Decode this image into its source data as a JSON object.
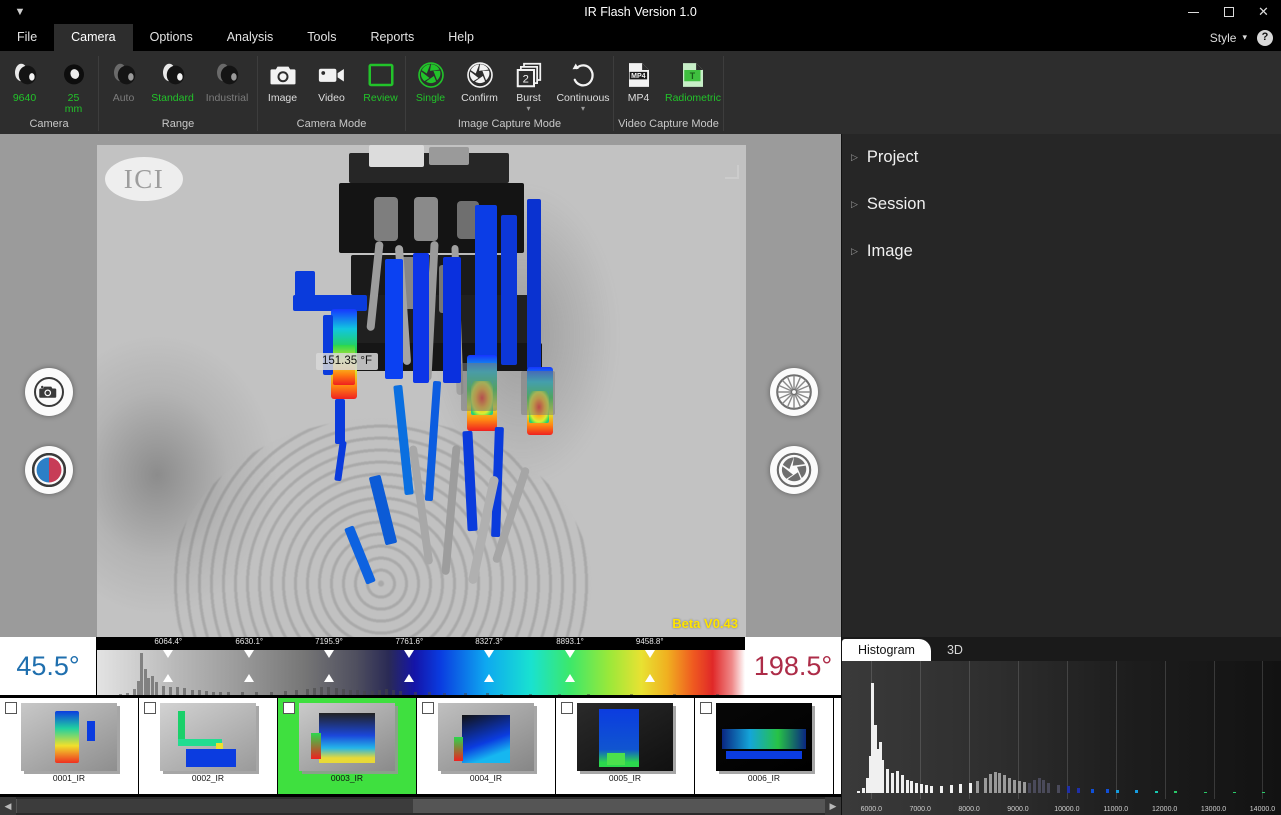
{
  "window": {
    "title": "IR Flash Version 1.0",
    "qat_icon": "quick-access-caret-icon",
    "minimize": "–",
    "maximize": "□",
    "close": "✕"
  },
  "menu": {
    "items": [
      {
        "label": "File",
        "active": false
      },
      {
        "label": "Camera",
        "active": true
      },
      {
        "label": "Options",
        "active": false
      },
      {
        "label": "Analysis",
        "active": false
      },
      {
        "label": "Tools",
        "active": false
      },
      {
        "label": "Reports",
        "active": false
      },
      {
        "label": "Help",
        "active": false
      }
    ],
    "style_label": "Style",
    "style_caret": "▾",
    "help_label": "?"
  },
  "ribbon": {
    "groups": [
      {
        "title": "Camera",
        "items": [
          {
            "label": "9640",
            "icon": "camera-lens-icon",
            "state": "green"
          },
          {
            "label": "25 mm",
            "label_line1": "25",
            "label_line2": "mm",
            "icon": "lens-front-icon",
            "state": "green"
          }
        ]
      },
      {
        "title": "Range",
        "items": [
          {
            "label": "Auto",
            "icon": "camera-lens-icon",
            "state": "dim"
          },
          {
            "label": "Standard",
            "icon": "camera-lens-icon",
            "state": "green"
          },
          {
            "label": "Industrial",
            "icon": "camera-lens-icon",
            "state": "dim"
          }
        ]
      },
      {
        "title": "Camera Mode",
        "items": [
          {
            "label": "Image",
            "icon": "photo-camera-icon",
            "state": "normal"
          },
          {
            "label": "Video",
            "icon": "video-camera-icon",
            "state": "normal"
          },
          {
            "label": "Review",
            "icon": "frame-outline-icon",
            "state": "green"
          }
        ]
      },
      {
        "title": "Image Capture Mode",
        "items": [
          {
            "label": "Single",
            "icon": "aperture-icon",
            "state": "green"
          },
          {
            "label": "Confirm",
            "icon": "aperture-icon",
            "state": "normal"
          },
          {
            "label": "Burst",
            "icon": "burst-stack-2-icon",
            "state": "normal",
            "caret": "▾"
          },
          {
            "label": "Continuous",
            "icon": "loop-arrow-icon",
            "state": "normal",
            "caret": "▾"
          }
        ]
      },
      {
        "title": "Video Capture Mode",
        "items": [
          {
            "label": "MP4",
            "icon": "mp4-file-icon",
            "state": "normal"
          },
          {
            "label": "Radiometric",
            "icon": "radiometric-file-icon",
            "state": "green"
          }
        ]
      }
    ]
  },
  "viewer": {
    "logo_text": "ICI",
    "temperature_tag": "151.35 °F",
    "beta_tag": "Beta V0.43",
    "left_buttons": [
      {
        "name": "camera-snapshot-button",
        "icon": "photo-camera-icon"
      },
      {
        "name": "palette-toggle-button",
        "icon": "palette-split-circle-icon"
      }
    ],
    "right_buttons": [
      {
        "name": "focus-button",
        "icon": "focus-sunburst-icon"
      },
      {
        "name": "aperture-button",
        "icon": "aperture-icon"
      }
    ],
    "center_button": {
      "name": "frame-capture-button",
      "icon": "frames-stack-icon"
    }
  },
  "scale": {
    "min_temp": "45.5°",
    "max_temp": "198.5°",
    "tick_labels": [
      "6064.4°",
      "6630.1°",
      "7195.9°",
      "7761.6°",
      "8327.3°",
      "8893.1°",
      "9458.8°"
    ],
    "tick_positions_pct": [
      11,
      23.5,
      35.8,
      48.2,
      60.5,
      73,
      85.3
    ],
    "min_color": "#1f6fae",
    "max_color": "#ad2c48"
  },
  "filmstrip": {
    "thumbnails": [
      {
        "label": "0001_IR",
        "selected": false
      },
      {
        "label": "0002_IR",
        "selected": false
      },
      {
        "label": "0003_IR",
        "selected": true
      },
      {
        "label": "0004_IR",
        "selected": false
      },
      {
        "label": "0005_IR",
        "selected": false
      },
      {
        "label": "0006_IR",
        "selected": false
      }
    ],
    "scroll_left": "◀",
    "scroll_right": "▶",
    "selection_color": "#3fe03f"
  },
  "right_panel": {
    "tree": [
      {
        "label": "Project",
        "expanded": false,
        "arrow": "▷"
      },
      {
        "label": "Session",
        "expanded": false,
        "arrow": "▷"
      },
      {
        "label": "Image",
        "expanded": false,
        "arrow": "▷"
      }
    ]
  },
  "histogram_panel": {
    "tabs": [
      {
        "label": "Histogram",
        "active": true
      },
      {
        "label": "3D",
        "active": false
      }
    ]
  },
  "chart_data": {
    "type": "bar",
    "title": "Histogram",
    "xlabel": "",
    "ylabel": "",
    "xlim": [
      5400,
      14400
    ],
    "grid": true,
    "legend": "none",
    "tick_labels": [
      "6000.0",
      "7000.0",
      "8000.0",
      "9000.0",
      "10000.0",
      "11000.0",
      "12000.0",
      "13000.0",
      "14000.0"
    ],
    "tick_values": [
      6000,
      7000,
      8000,
      9000,
      10000,
      11000,
      12000,
      13000,
      14000
    ],
    "x": [
      5700,
      5800,
      5900,
      5950,
      6000,
      6050,
      6100,
      6150,
      6200,
      6300,
      6400,
      6500,
      6600,
      6700,
      6800,
      6900,
      7000,
      7100,
      7200,
      7400,
      7600,
      7800,
      8000,
      8150,
      8300,
      8400,
      8500,
      8600,
      8700,
      8800,
      8900,
      9000,
      9100,
      9200,
      9300,
      9400,
      9500,
      9600,
      9800,
      10000,
      10200,
      10500,
      10800,
      11000,
      11400,
      11800,
      12200,
      12800,
      13400,
      14000
    ],
    "values": [
      2,
      5,
      14,
      34,
      100,
      62,
      40,
      46,
      30,
      22,
      18,
      20,
      16,
      12,
      11,
      9,
      8,
      7,
      6,
      6,
      7,
      8,
      9,
      11,
      14,
      17,
      19,
      18,
      16,
      14,
      12,
      11,
      10,
      9,
      12,
      14,
      12,
      9,
      7,
      6,
      5,
      4,
      4,
      3,
      3,
      2,
      2,
      1,
      1,
      1
    ]
  }
}
